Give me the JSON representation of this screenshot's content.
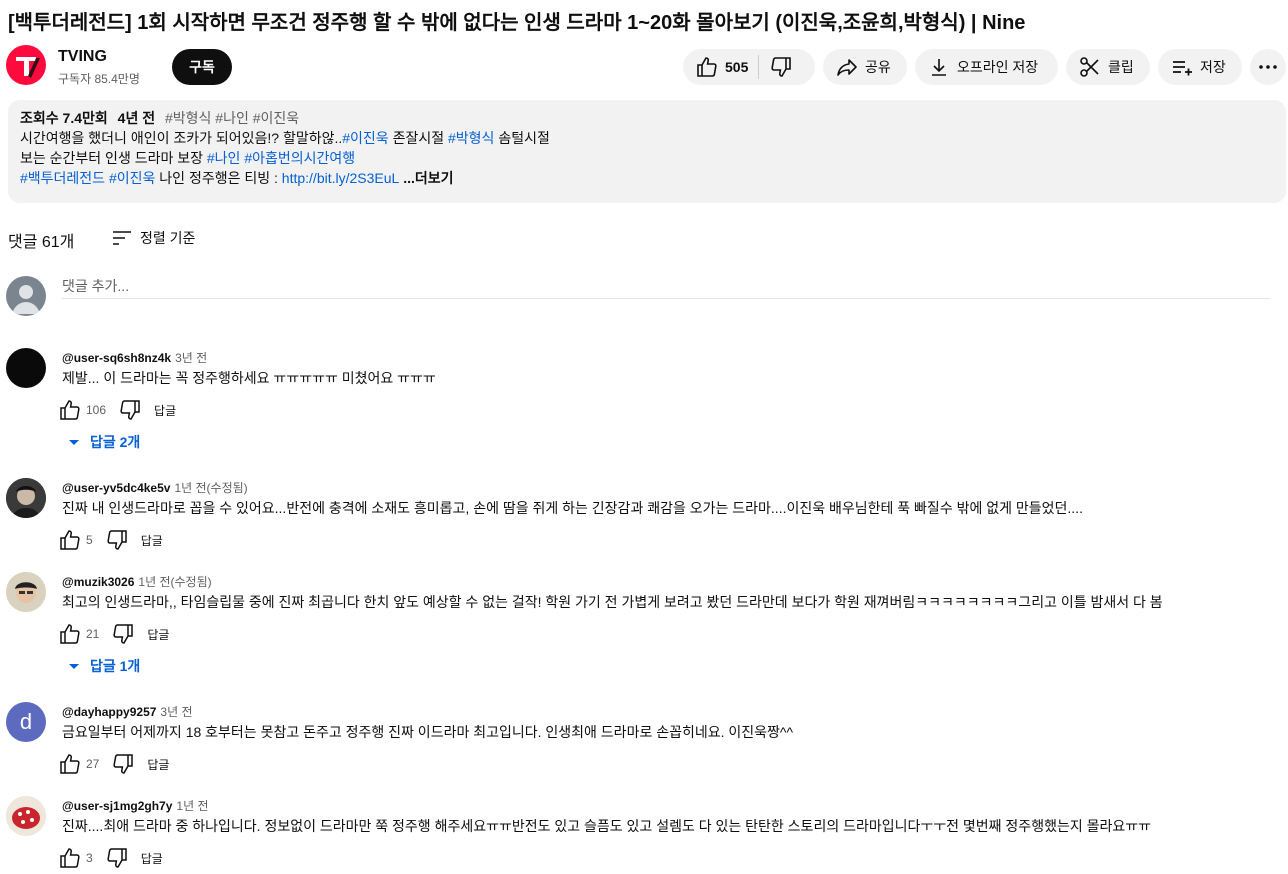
{
  "video": {
    "title": "[백투더레전드] 1회 시작하면 무조건 정주행 할 수 밖에 없다는 인생 드라마 1~20화 몰아보기 (이진욱,조윤희,박형식) | Nine"
  },
  "channel": {
    "name": "TVING",
    "subscribers": "구독자 85.4만명",
    "subscribe_label": "구독",
    "brand_color": "#ff0a3c"
  },
  "actions": {
    "like_count": "505",
    "share_label": "공유",
    "offline_label": "오프라인 저장",
    "clip_label": "클립",
    "save_label": "저장"
  },
  "description": {
    "views": "조회수 7.4만회",
    "age": "4년 전",
    "tags": "#박형식 #나인 #이진욱",
    "line1_a": "시간여행을 했더니 애인이 조카가 되어있음!? 할말하않..",
    "line1_tag1": "#이진욱",
    "line1_b": " 존잘시절 ",
    "line1_tag2": "#박형식",
    "line1_c": " 솜털시절",
    "line2_a": "보는 순간부터 인생 드라마 보장 ",
    "line2_tag1": "#나인",
    "line2_sp": " ",
    "line2_tag2": "#아홉번의시간여행",
    "line3_tag1": "#백투더레전드",
    "line3_sp": " ",
    "line3_tag2": "#이진욱",
    "line3_a": " 나인 정주행은 티빙 : ",
    "line3_link": "http://bit.ly/2S3EuL",
    "more_label": " ...더보기"
  },
  "comments_section": {
    "count_label": "댓글 61개",
    "sort_label": "정렬 기준",
    "add_placeholder": "댓글 추가..."
  },
  "comments": [
    {
      "author": "@user-sq6sh8nz4k",
      "time": "3년 전",
      "text": "제발... 이 드라마는 꼭 정주행하세요 ㅠㅠㅠㅠㅠ 미쳤어요 ㅠㅠㅠ",
      "likes": "106",
      "reply_label": "답글",
      "replies_label": "답글 2개"
    },
    {
      "author": "@user-yv5dc4ke5v",
      "time": "1년 전(수정됨)",
      "text": "진짜 내 인생드라마로 꼽을 수 있어요...반전에 충격에 소재도 흥미롭고, 손에 땀을 쥐게 하는 긴장감과 쾌감을 오가는 드라마....이진욱 배우님한테 푹 빠질수 밖에 없게 만들었던....",
      "likes": "5",
      "reply_label": "답글"
    },
    {
      "author": "@muzik3026",
      "time": "1년 전(수정됨)",
      "text": "최고의 인생드라마,, 타임슬립물 중에 진짜 최곱니다 한치 앞도 예상할 수 없는 걸작! 학원 가기 전 가볍게 보려고 봤던 드라만데 보다가 학원 재껴버림ㅋㅋㅋㅋㅋㅋㅋㅋ그리고 이틀 밤새서 다 봄",
      "likes": "21",
      "reply_label": "답글",
      "replies_label": "답글 1개"
    },
    {
      "author": "@dayhappy9257",
      "time": "3년 전",
      "text": "금요일부터 어제까지  18 호부터는 못참고 돈주고 정주행 진짜 이드라마 최고입니다. 인생최애 드라마로  손꼽히네요. 이진욱짱^^",
      "likes": "27",
      "reply_label": "답글",
      "avatar_letter": "d",
      "avatar_color": "#5c6bc0"
    },
    {
      "author": "@user-sj1mg2gh7y",
      "time": "1년 전",
      "text": "진짜....최애 드라마 중 하나입니다. 정보없이 드라마만 쭉 정주행 해주세요ㅠㅠ반전도 있고 슬픔도 있고 설렘도 다 있는 탄탄한 스토리의 드라마입니다ㅜㅜ전 몇번째 정주행했는지 몰라요ㅠㅠ",
      "likes": "3",
      "reply_label": "답글"
    }
  ]
}
